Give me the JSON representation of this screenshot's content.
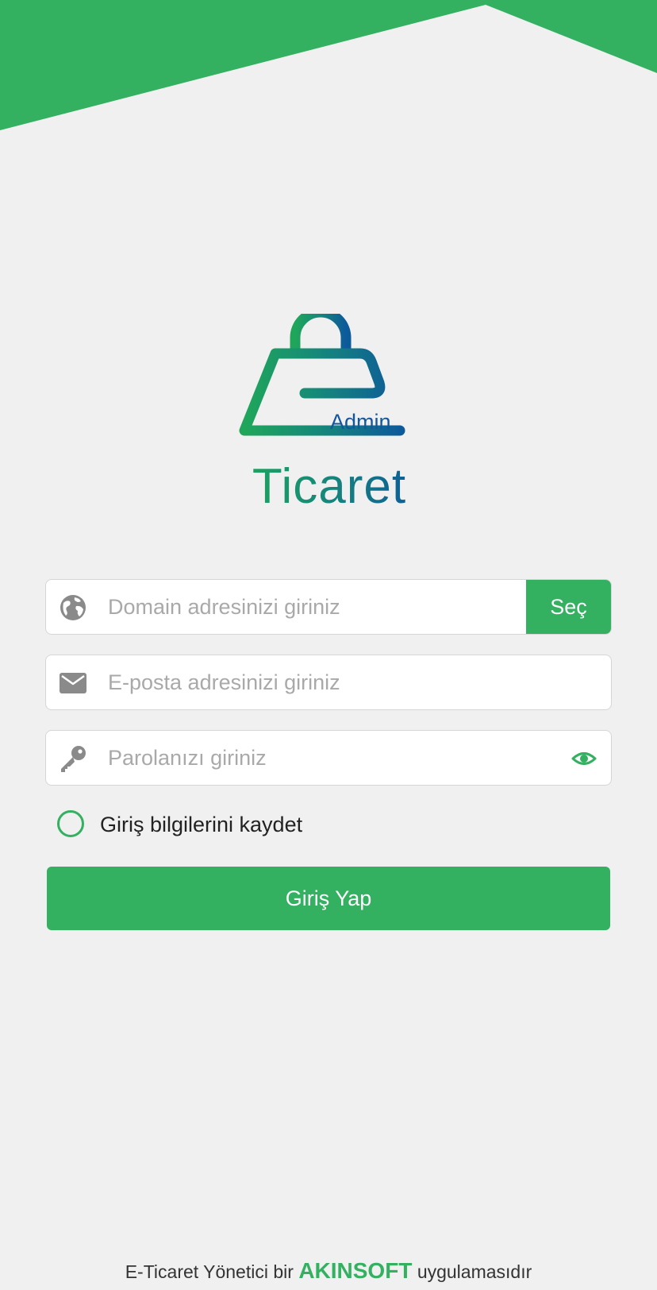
{
  "colors": {
    "accent": "#34b061",
    "background": "#f0f0f0",
    "brand_blue": "#12569c"
  },
  "logo": {
    "badge": "Admin",
    "wordmark": "Ticaret"
  },
  "domain": {
    "icon": "globe-icon",
    "value": "",
    "placeholder": "Domain adresinizi giriniz",
    "select_label": "Seç"
  },
  "email": {
    "icon": "envelope-icon",
    "value": "",
    "placeholder": "E-posta adresinizi giriniz"
  },
  "password": {
    "icon": "key-icon",
    "value": "",
    "placeholder": "Parolanızı giriniz",
    "toggle_icon": "eye-icon"
  },
  "remember": {
    "label": "Giriş bilgilerini kaydet",
    "checked": false
  },
  "login_button": "Giriş Yap",
  "footer": {
    "prefix": "E-Ticaret Yönetici bir",
    "brand": "AKINSOFT",
    "suffix": "uygulamasıdır"
  }
}
